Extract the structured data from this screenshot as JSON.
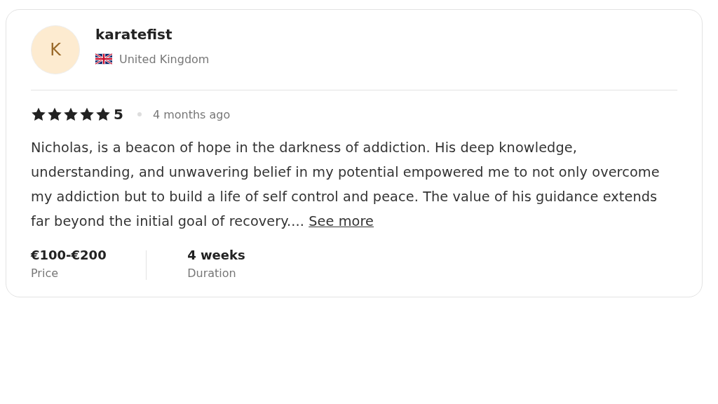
{
  "reviewer": {
    "initial": "K",
    "name": "karatefist",
    "country": "United Kingdom"
  },
  "rating": {
    "stars": 5,
    "score": "5",
    "time": "4 months ago"
  },
  "review": {
    "text": "Nicholas, is a beacon of hope in the darkness of addiction. His deep knowledge, understanding, and unwavering belief in my potential empowered me to not only overcome my addiction but to build a life of self control and peace. The value of his guidance extends far beyond the initial goal of recovery....",
    "link": "See more"
  },
  "details": [
    {
      "value": "€100-€200",
      "label": "Price"
    },
    {
      "value": "4 weeks",
      "label": "Duration"
    }
  ]
}
